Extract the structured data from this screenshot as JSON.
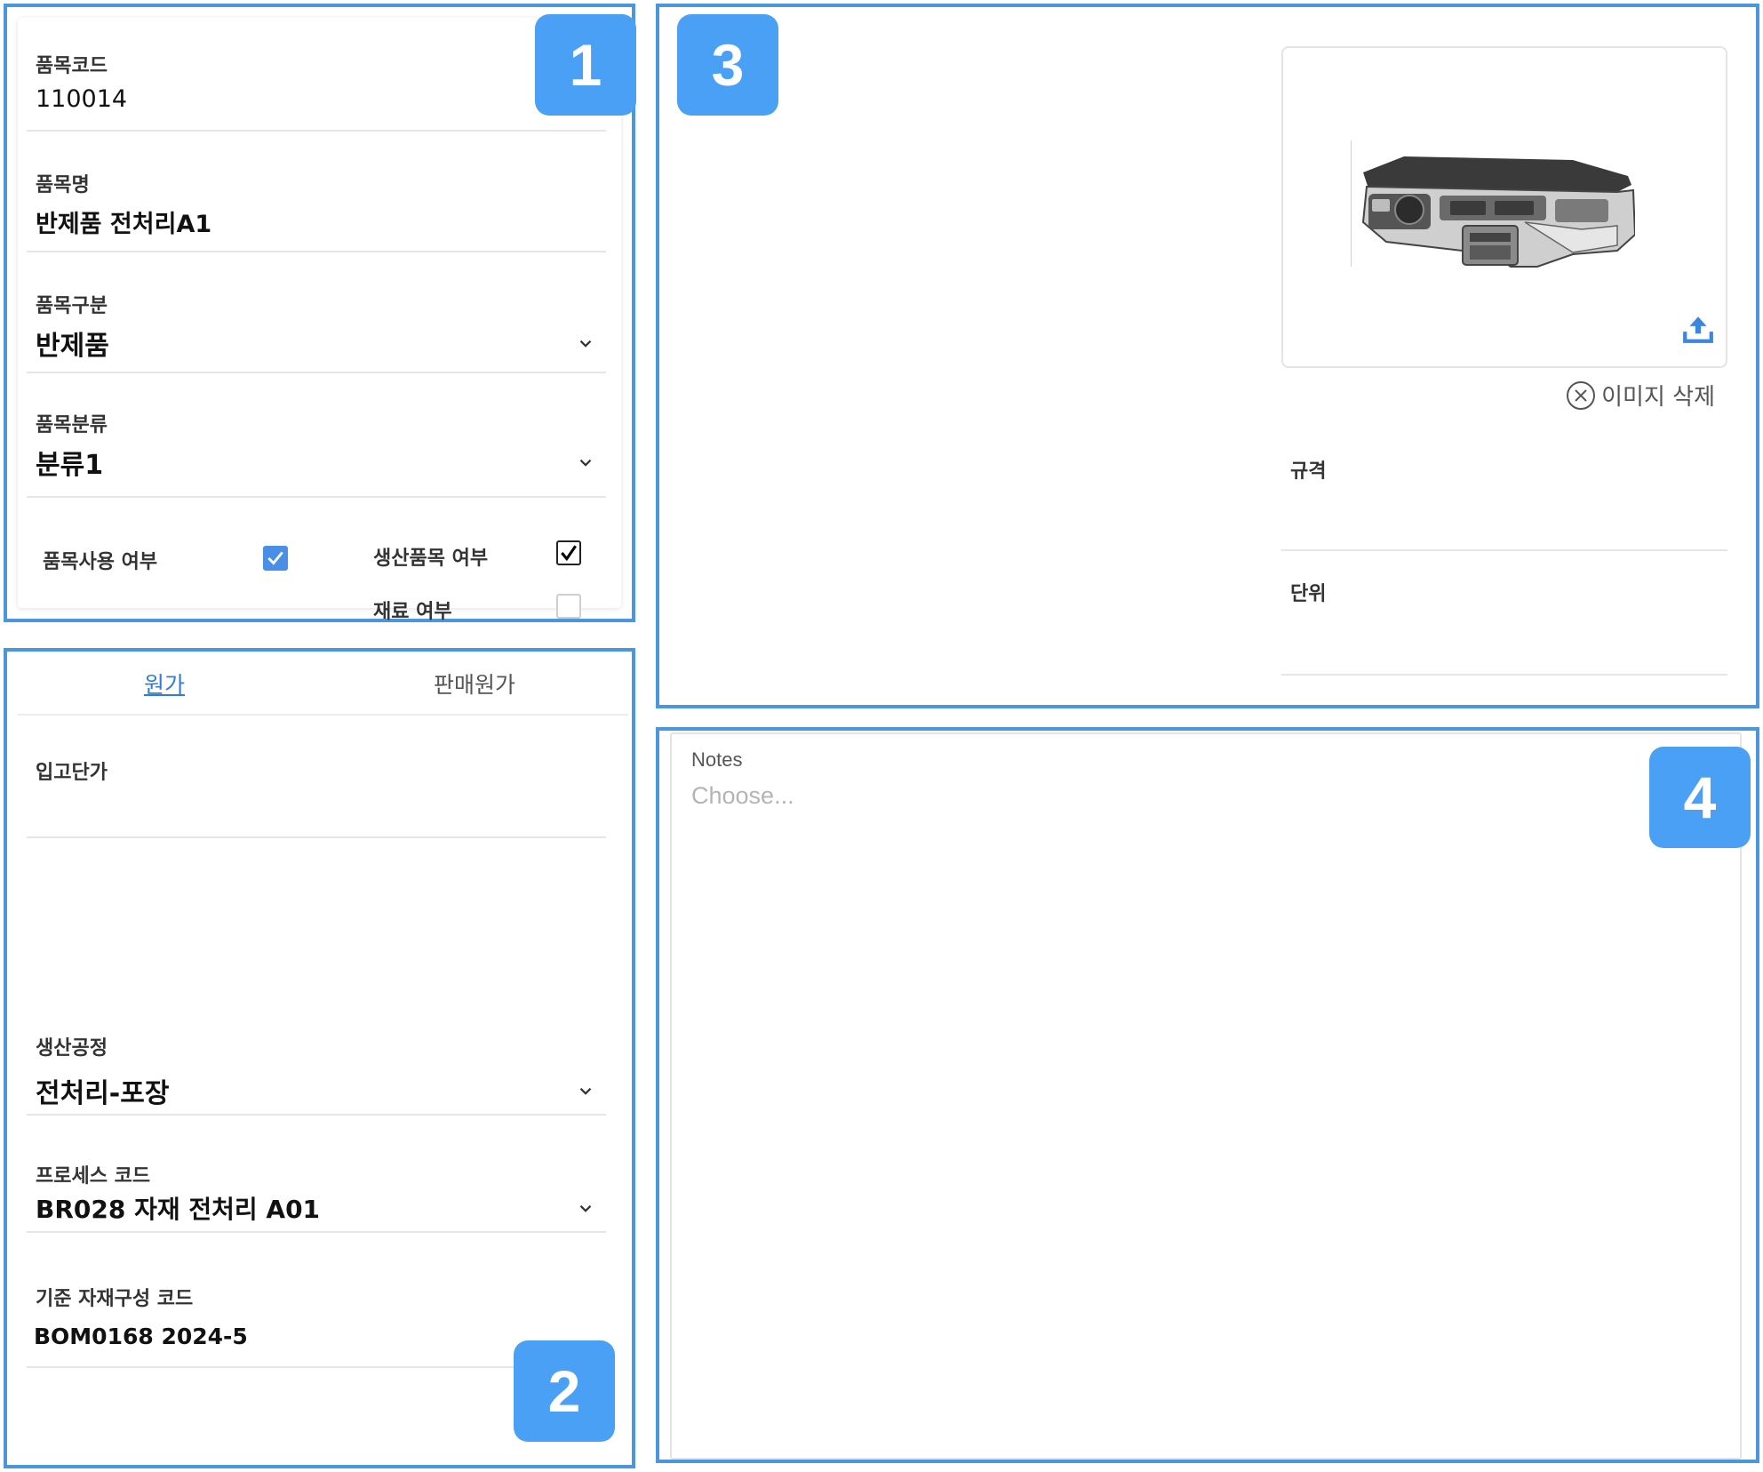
{
  "badges": {
    "one": "1",
    "two": "2",
    "three": "3",
    "four": "4"
  },
  "item_info": {
    "item_code": {
      "label": "품목코드",
      "value": "110014"
    },
    "item_name": {
      "label": "품목명",
      "value": "반제품 전처리A1"
    },
    "item_type": {
      "label": "품목구분",
      "value": "반제품"
    },
    "item_category": {
      "label": "품목분류",
      "value": "분류1"
    },
    "checkboxes": {
      "in_use": {
        "label": "품목사용 여부",
        "checked": true
      },
      "production_item": {
        "label": "생산품목 여부",
        "checked": true
      },
      "material": {
        "label": "재료 여부",
        "checked": false
      }
    }
  },
  "cost": {
    "tabs": [
      {
        "label": "원가",
        "active": true
      },
      {
        "label": "판매원가",
        "active": false
      }
    ],
    "receiving_unit_price": {
      "label": "입고단가",
      "value": ""
    },
    "production_process": {
      "label": "생산공정",
      "value": "전처리-포장"
    },
    "process_code": {
      "label": "프로세스 코드",
      "value": "BR028 자재 전처리 A01"
    },
    "bom_code": {
      "label": "기준 자재구성 코드",
      "value": "BOM0168 2024-5"
    }
  },
  "image_section": {
    "image_icon": "car-dashboard-image",
    "upload_icon": "upload-icon",
    "delete_label": "이미지 삭제",
    "spec": {
      "label": "규격",
      "value": ""
    },
    "unit": {
      "label": "단위",
      "value": ""
    }
  },
  "notes": {
    "label": "Notes",
    "placeholder": "Choose..."
  },
  "colors": {
    "accent": "#4a97e0",
    "badge": "#4aa0f5",
    "active_tab": "#2f7dd6",
    "checkbox": "#4a8fe7"
  }
}
